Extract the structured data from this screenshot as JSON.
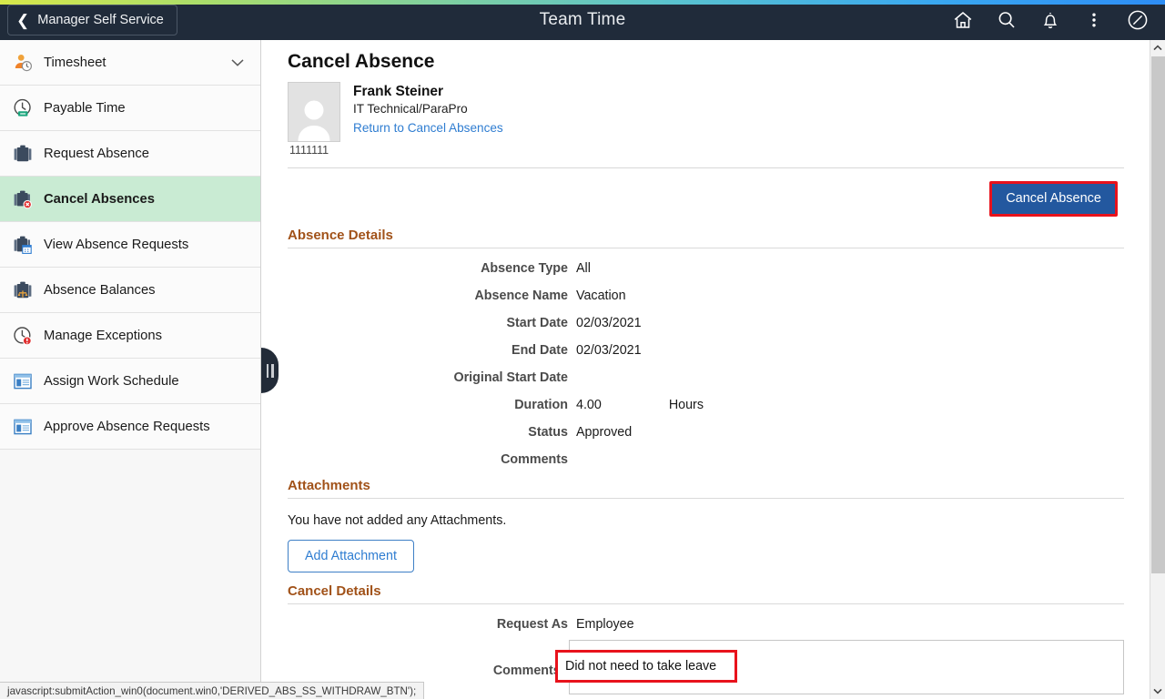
{
  "header": {
    "back_label": "Manager Self Service",
    "title": "Team Time",
    "icons": [
      {
        "name": "home-icon",
        "label": "Home"
      },
      {
        "name": "search-icon",
        "label": "Search"
      },
      {
        "name": "notifications-bell-icon",
        "label": "Notifications"
      },
      {
        "name": "actions-kebab-icon",
        "label": "Actions"
      },
      {
        "name": "navbar-compass-icon",
        "label": "NavBar"
      }
    ]
  },
  "sidebar": {
    "items": [
      {
        "label": "Timesheet",
        "icon": "timesheet-person-clock-icon",
        "selected": false,
        "has_chevron": true
      },
      {
        "label": "Payable Time",
        "icon": "payable-time-clock-icon",
        "selected": false,
        "has_chevron": false
      },
      {
        "label": "Request Absence",
        "icon": "briefcase-icon",
        "selected": false,
        "has_chevron": false
      },
      {
        "label": "Cancel Absences",
        "icon": "briefcase-cancel-icon",
        "selected": true,
        "has_chevron": false
      },
      {
        "label": "View Absence Requests",
        "icon": "briefcase-calendar-icon",
        "selected": false,
        "has_chevron": false
      },
      {
        "label": "Absence Balances",
        "icon": "briefcase-balance-icon",
        "selected": false,
        "has_chevron": false
      },
      {
        "label": "Manage Exceptions",
        "icon": "clock-alert-icon",
        "selected": false,
        "has_chevron": false
      },
      {
        "label": "Assign Work Schedule",
        "icon": "window-page-icon",
        "selected": false,
        "has_chevron": false
      },
      {
        "label": "Approve Absence Requests",
        "icon": "window-page-icon",
        "selected": false,
        "has_chevron": false
      }
    ]
  },
  "main": {
    "page_title": "Cancel Absence",
    "person": {
      "name": "Frank Steiner",
      "job_title": "IT Technical/ParaPro",
      "return_link": "Return to Cancel Absences",
      "emplid": "1111111"
    },
    "cancel_absence_button": "Cancel Absence",
    "absence_details": {
      "heading": "Absence Details",
      "fields": [
        {
          "label": "Absence Type",
          "value": "All",
          "value2": ""
        },
        {
          "label": "Absence Name",
          "value": "Vacation",
          "value2": ""
        },
        {
          "label": "Start Date",
          "value": "02/03/2021",
          "value2": ""
        },
        {
          "label": "End Date",
          "value": "02/03/2021",
          "value2": ""
        },
        {
          "label": "Original Start Date",
          "value": "",
          "value2": ""
        },
        {
          "label": "Duration",
          "value": "4.00",
          "value2": "Hours"
        },
        {
          "label": "Status",
          "value": "Approved",
          "value2": ""
        },
        {
          "label": "Comments",
          "value": "",
          "value2": ""
        }
      ]
    },
    "attachments": {
      "heading": "Attachments",
      "empty_text": "You have not added any Attachments.",
      "add_button": "Add Attachment"
    },
    "cancel_details": {
      "heading": "Cancel Details",
      "request_as_label": "Request As",
      "request_as_value": "Employee",
      "comments_label": "Comments",
      "comments_value": "Did not need to take leave"
    }
  },
  "status_bar": {
    "text": "javascript:submitAction_win0(document.win0,'DERIVED_ABS_SS_WITHDRAW_BTN');"
  },
  "colors": {
    "header_bg": "#202b3a",
    "selected_nav": "#c9ebd3",
    "section_heading": "#a15219",
    "primary_button": "#23589f",
    "highlight_border": "#e8121c",
    "link": "#2f7dd1"
  }
}
